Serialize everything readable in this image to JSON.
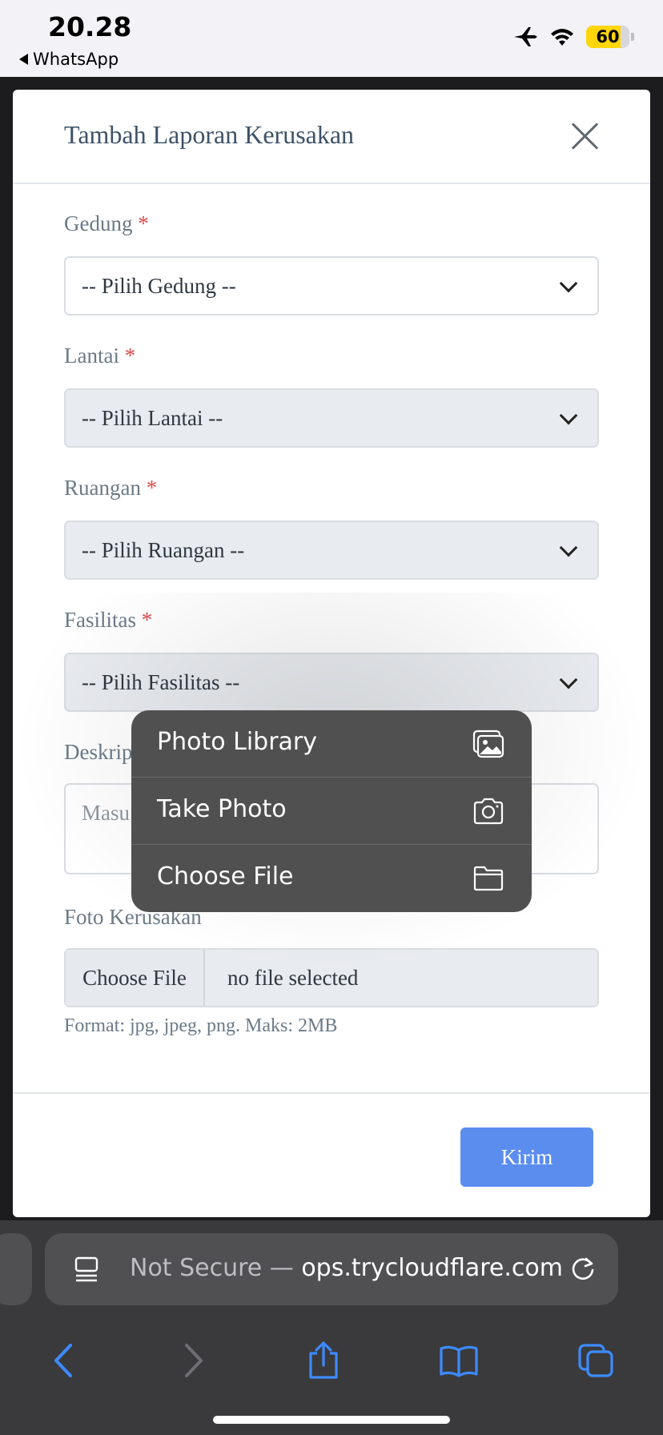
{
  "status_bar": {
    "time": "20.28",
    "back_app": "WhatsApp",
    "battery": "60"
  },
  "modal": {
    "title": "Tambah Laporan Kerusakan",
    "fields": {
      "gedung": {
        "label": "Gedung",
        "required": "*",
        "value": "-- Pilih Gedung --"
      },
      "lantai": {
        "label": "Lantai",
        "required": "*",
        "value": "-- Pilih Lantai --"
      },
      "ruangan": {
        "label": "Ruangan",
        "required": "*",
        "value": "-- Pilih Ruangan --"
      },
      "fasilitas": {
        "label": "Fasilitas",
        "required": "*",
        "value": "-- Pilih Fasilitas --"
      },
      "deskripsi": {
        "label": "Deskrip",
        "placeholder": "Masu"
      },
      "foto": {
        "label": "Foto Kerusakan",
        "button": "Choose File",
        "status": "no file selected",
        "hint": "Format: jpg, jpeg, png. Maks: 2MB"
      }
    },
    "submit_label": "Kirim"
  },
  "file_menu": {
    "items": [
      {
        "label": "Photo Library",
        "icon": "photo-library-icon"
      },
      {
        "label": "Take Photo",
        "icon": "camera-icon"
      },
      {
        "label": "Choose File",
        "icon": "folder-icon"
      }
    ]
  },
  "browser": {
    "url_prefix": "Not Secure — ",
    "url_host": "ops.trycloudflare.com",
    "accent": "#3d8bff"
  }
}
